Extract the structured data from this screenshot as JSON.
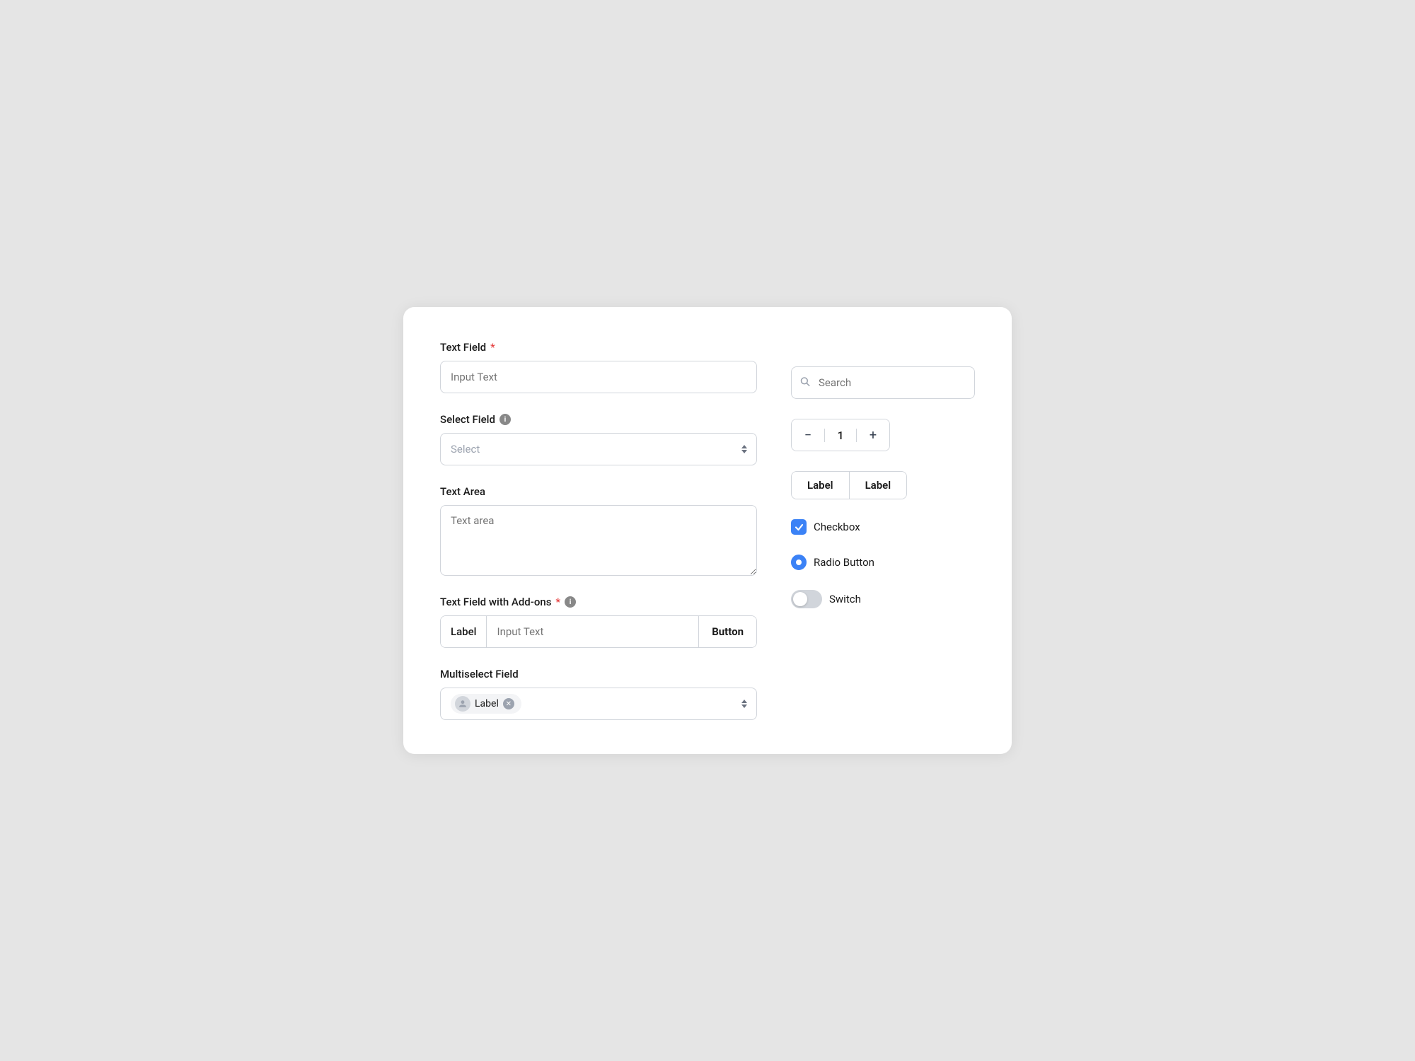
{
  "card": {
    "left": {
      "text_field": {
        "label": "Text Field",
        "required": true,
        "placeholder": "Input Text"
      },
      "select_field": {
        "label": "Select Field",
        "has_info": true,
        "placeholder": "Select"
      },
      "text_area": {
        "label": "Text Area",
        "placeholder": "Text area"
      },
      "addon_field": {
        "label": "Text Field with Add-ons",
        "required": true,
        "has_info": true,
        "addon_label": "Label",
        "placeholder": "Input Text",
        "button_label": "Button"
      },
      "multiselect": {
        "label": "Multiselect Field",
        "tag_label": "Label"
      }
    },
    "right": {
      "search": {
        "placeholder": "Search"
      },
      "stepper": {
        "value": 1,
        "decrement": "−",
        "increment": "+"
      },
      "button_group": {
        "label1": "Label",
        "label2": "Label"
      },
      "checkbox": {
        "label": "Checkbox",
        "checked": true
      },
      "radio": {
        "label": "Radio Button",
        "checked": true
      },
      "switch": {
        "label": "Switch",
        "on": false
      }
    }
  }
}
